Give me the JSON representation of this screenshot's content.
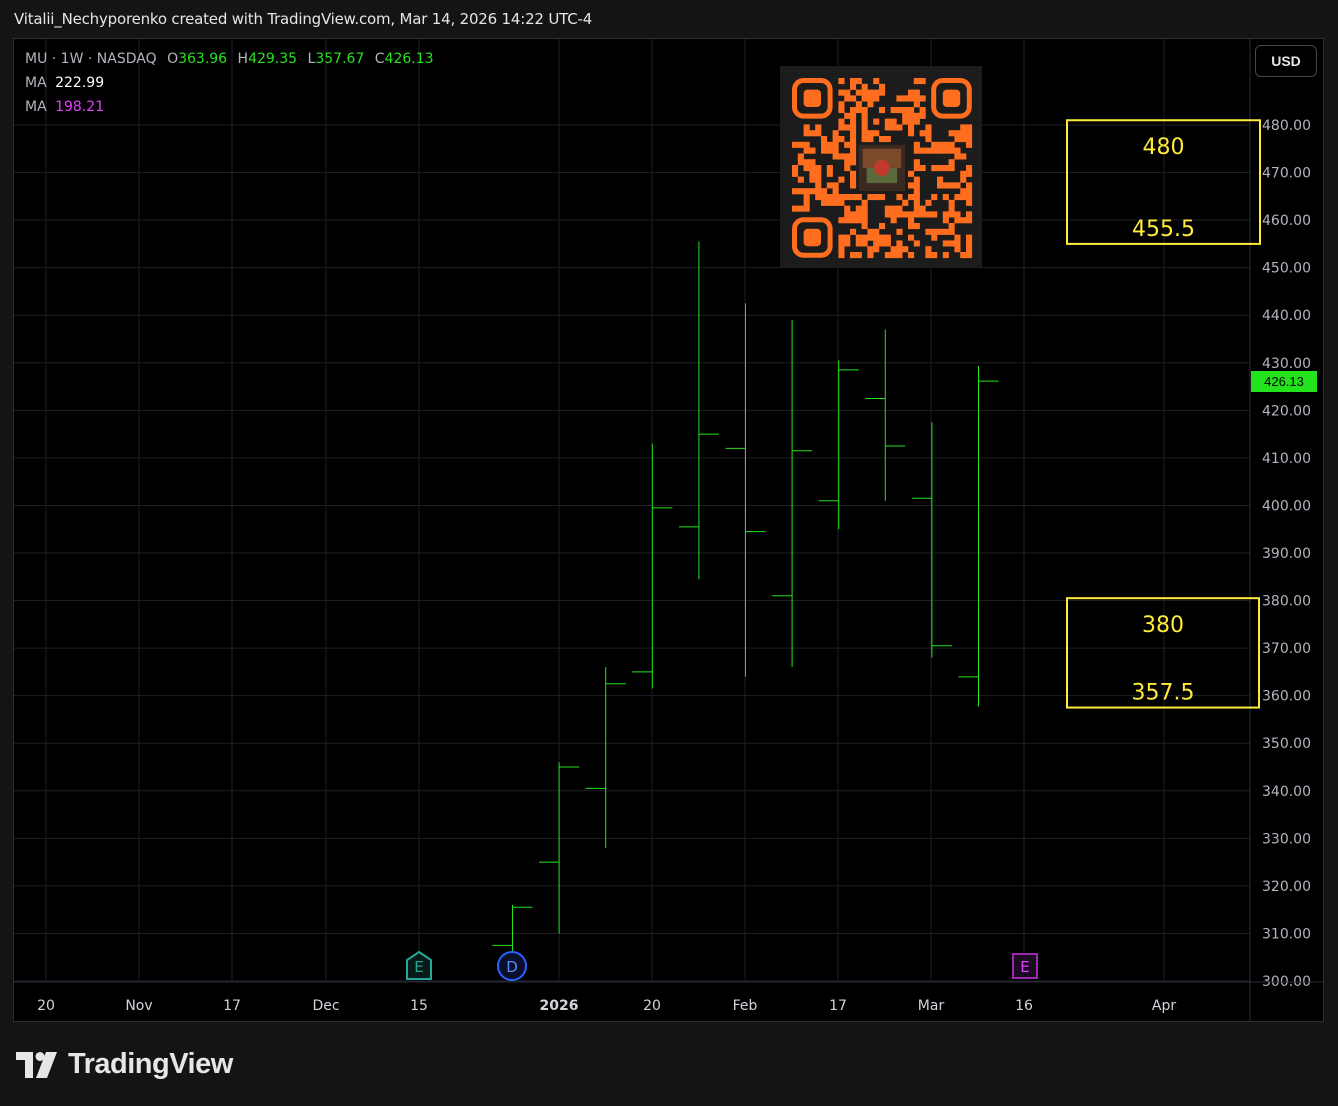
{
  "header": {
    "watermark": "Vitalii_Nechyporenko created with TradingView.com, Mar 14, 2026 14:22 UTC-4"
  },
  "legend": {
    "symbol": "MU · 1W · NASDAQ",
    "o_label": "O",
    "o_value": "363.96",
    "h_label": "H",
    "h_value": "429.35",
    "l_label": "L",
    "l_value": "357.67",
    "c_label": "C",
    "c_value": "426.13",
    "ma1_label": "MA",
    "ma1_value": "222.99",
    "ma2_label": "MA",
    "ma2_value": "198.21"
  },
  "currency_button": "USD",
  "last_price_tag": "426.13",
  "brand": {
    "name": "TradingView"
  },
  "colors": {
    "bar": "#26e31e",
    "zone": "#ffeb3b",
    "grid": "#1c1f26",
    "earnings_teal": "#26a69a",
    "dividend_blue": "#2962ff",
    "earnings_purple": "#9c27b0",
    "qr_orange": "#ff6d1f"
  },
  "chart_data": {
    "type": "ohlc-bar",
    "title": "",
    "interval": "1W",
    "y_range": [
      300,
      490
    ],
    "y_ticks": [
      "480.00",
      "470.00",
      "460.00",
      "450.00",
      "440.00",
      "430.00",
      "420.00",
      "410.00",
      "400.00",
      "390.00",
      "380.00",
      "370.00",
      "360.00",
      "350.00",
      "340.00",
      "330.00",
      "320.00",
      "310.00",
      "300.00"
    ],
    "x_tick_labels": [
      "20",
      "Nov",
      "17",
      "Dec",
      "15",
      "2026",
      "20",
      "Feb",
      "17",
      "Mar",
      "16",
      "Apr"
    ],
    "bars": [
      {
        "o": 307.5,
        "h": 316,
        "l": 306,
        "c": 315.5
      },
      {
        "o": 325,
        "h": 346,
        "l": 310,
        "c": 345
      },
      {
        "o": 340.5,
        "h": 366,
        "l": 328,
        "c": 362.5
      },
      {
        "o": 365,
        "h": 413,
        "l": 361.5,
        "c": 399.5
      },
      {
        "o": 395.5,
        "h": 455.5,
        "l": 384.5,
        "c": 415
      },
      {
        "o": 412,
        "h": 442.5,
        "l": 364,
        "c": 394.5
      },
      {
        "o": 381,
        "h": 439,
        "l": 366,
        "c": 411.5
      },
      {
        "o": 401,
        "h": 430.5,
        "l": 395,
        "c": 428.5
      },
      {
        "o": 422.5,
        "h": 437,
        "l": 401,
        "c": 412.5
      },
      {
        "o": 401.5,
        "h": 417.5,
        "l": 368,
        "c": 370.5
      },
      {
        "o": 363.96,
        "h": 429.35,
        "l": 357.67,
        "c": 426.13
      }
    ],
    "zones": [
      {
        "top_label": "480",
        "bottom_label": "455.5",
        "top": 481,
        "bottom": 455
      },
      {
        "top_label": "380",
        "bottom_label": "357.5",
        "top": 380.5,
        "bottom": 357.5
      }
    ],
    "events": [
      {
        "label": "E",
        "kind": "earnings-past"
      },
      {
        "label": "D",
        "kind": "dividend"
      },
      {
        "label": "E",
        "kind": "earnings-upcoming"
      }
    ]
  }
}
